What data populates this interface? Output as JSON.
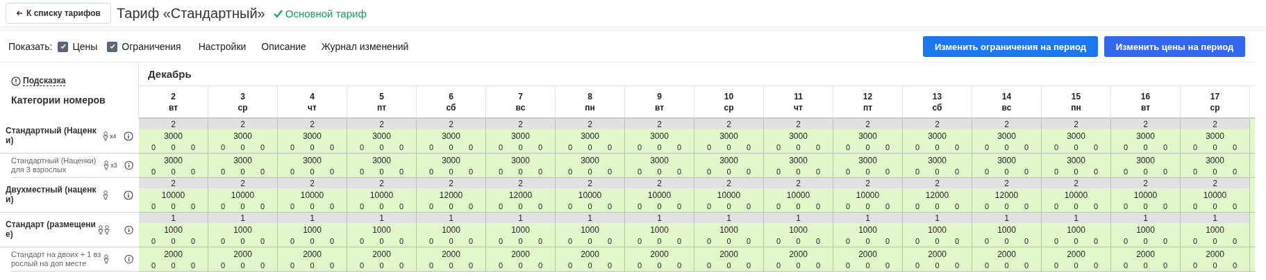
{
  "header": {
    "back_button": "К списку тарифов",
    "title": "Тариф «Стандартный»",
    "status": "Основной тариф"
  },
  "toolbar": {
    "show_label": "Показать:",
    "filters": [
      {
        "label": "Цены",
        "checked": true
      },
      {
        "label": "Ограничения",
        "checked": true
      }
    ],
    "links": [
      "Настройки",
      "Описание",
      "Журнал изменений"
    ],
    "buttons": [
      {
        "label": "Изменить ограничения на период",
        "kind": "restrictions"
      },
      {
        "label": "Изменить цены на период",
        "kind": "prices"
      }
    ]
  },
  "table": {
    "hint": "Подсказка",
    "categories_heading": "Категории номеров",
    "month": "Декабрь",
    "days": [
      {
        "date": "2",
        "weekday": "вт"
      },
      {
        "date": "3",
        "weekday": "ср"
      },
      {
        "date": "4",
        "weekday": "чт"
      },
      {
        "date": "5",
        "weekday": "пт"
      },
      {
        "date": "6",
        "weekday": "сб"
      },
      {
        "date": "7",
        "weekday": "вс"
      },
      {
        "date": "8",
        "weekday": "пн"
      },
      {
        "date": "9",
        "weekday": "вт"
      },
      {
        "date": "10",
        "weekday": "ср"
      },
      {
        "date": "11",
        "weekday": "чт"
      },
      {
        "date": "12",
        "weekday": "пт"
      },
      {
        "date": "13",
        "weekday": "сб"
      },
      {
        "date": "14",
        "weekday": "вс"
      },
      {
        "date": "15",
        "weekday": "пн"
      },
      {
        "date": "16",
        "weekday": "вт"
      },
      {
        "date": "17",
        "weekday": "ср"
      }
    ],
    "rows": [
      {
        "name": "Стандартный (Наценки)",
        "kind": "main",
        "guest_icons": [
          {
            "kind": "adult"
          }
        ],
        "multiplier": "x4",
        "cells": [
          {
            "availability": "2",
            "price": "3000",
            "extras": [
              "0",
              "0",
              "0"
            ]
          },
          {
            "availability": "2",
            "price": "3000",
            "extras": [
              "0",
              "0",
              "0"
            ]
          },
          {
            "availability": "2",
            "price": "3000",
            "extras": [
              "0",
              "0",
              "0"
            ]
          },
          {
            "availability": "2",
            "price": "3000",
            "extras": [
              "0",
              "0",
              "0"
            ]
          },
          {
            "availability": "2",
            "price": "3000",
            "extras": [
              "0",
              "0",
              "0"
            ]
          },
          {
            "availability": "2",
            "price": "3000",
            "extras": [
              "0",
              "0",
              "0"
            ]
          },
          {
            "availability": "2",
            "price": "3000",
            "extras": [
              "0",
              "0",
              "0"
            ]
          },
          {
            "availability": "2",
            "price": "3000",
            "extras": [
              "0",
              "0",
              "0"
            ]
          },
          {
            "availability": "2",
            "price": "3000",
            "extras": [
              "0",
              "0",
              "0"
            ]
          },
          {
            "availability": "2",
            "price": "3000",
            "extras": [
              "0",
              "0",
              "0"
            ]
          },
          {
            "availability": "2",
            "price": "3000",
            "extras": [
              "0",
              "0",
              "0"
            ]
          },
          {
            "availability": "2",
            "price": "3000",
            "extras": [
              "0",
              "0",
              "0"
            ]
          },
          {
            "availability": "2",
            "price": "3000",
            "extras": [
              "0",
              "0",
              "0"
            ]
          },
          {
            "availability": "2",
            "price": "3000",
            "extras": [
              "0",
              "0",
              "0"
            ]
          },
          {
            "availability": "2",
            "price": "3000",
            "extras": [
              "0",
              "0",
              "0"
            ]
          },
          {
            "availability": "2",
            "price": "3000",
            "extras": [
              "0",
              "0",
              "0"
            ]
          }
        ]
      },
      {
        "name": "Стандартный (Наценки) для 3 взрослых",
        "kind": "sub",
        "guest_icons": [
          {
            "kind": "adult"
          }
        ],
        "multiplier": "x3",
        "cells": [
          {
            "price": "3000",
            "extras": [
              "0",
              "0",
              "0"
            ]
          },
          {
            "price": "3000",
            "extras": [
              "0",
              "0",
              "0"
            ]
          },
          {
            "price": "3000",
            "extras": [
              "0",
              "0",
              "0"
            ]
          },
          {
            "price": "3000",
            "extras": [
              "0",
              "0",
              "0"
            ]
          },
          {
            "price": "3000",
            "extras": [
              "0",
              "0",
              "0"
            ]
          },
          {
            "price": "3000",
            "extras": [
              "0",
              "0",
              "0"
            ]
          },
          {
            "price": "3000",
            "extras": [
              "0",
              "0",
              "0"
            ]
          },
          {
            "price": "3000",
            "extras": [
              "0",
              "0",
              "0"
            ]
          },
          {
            "price": "3000",
            "extras": [
              "0",
              "0",
              "0"
            ]
          },
          {
            "price": "3000",
            "extras": [
              "0",
              "0",
              "0"
            ]
          },
          {
            "price": "3000",
            "extras": [
              "0",
              "0",
              "0"
            ]
          },
          {
            "price": "3000",
            "extras": [
              "0",
              "0",
              "0"
            ]
          },
          {
            "price": "3000",
            "extras": [
              "0",
              "0",
              "0"
            ]
          },
          {
            "price": "3000",
            "extras": [
              "0",
              "0",
              "0"
            ]
          },
          {
            "price": "3000",
            "extras": [
              "0",
              "0",
              "0"
            ]
          },
          {
            "price": "3000",
            "extras": [
              "0",
              "0",
              "0"
            ]
          }
        ]
      },
      {
        "name": "Двухместный (наценки)",
        "kind": "main",
        "guest_icons": [
          {
            "kind": "adult"
          }
        ],
        "cells": [
          {
            "availability": "2",
            "price": "10000",
            "extras": [
              "0",
              "0",
              "0"
            ]
          },
          {
            "availability": "2",
            "price": "10000",
            "extras": [
              "0",
              "0",
              "0"
            ]
          },
          {
            "availability": "2",
            "price": "10000",
            "extras": [
              "0",
              "0",
              "0"
            ]
          },
          {
            "availability": "2",
            "price": "10000",
            "extras": [
              "0",
              "0",
              "0"
            ]
          },
          {
            "availability": "2",
            "price": "12000",
            "extras": [
              "0",
              "0",
              "0"
            ]
          },
          {
            "availability": "2",
            "price": "12000",
            "extras": [
              "0",
              "0",
              "0"
            ]
          },
          {
            "availability": "2",
            "price": "10000",
            "extras": [
              "0",
              "0",
              "0"
            ]
          },
          {
            "availability": "2",
            "price": "10000",
            "extras": [
              "0",
              "0",
              "0"
            ]
          },
          {
            "availability": "2",
            "price": "10000",
            "extras": [
              "0",
              "0",
              "0"
            ]
          },
          {
            "availability": "2",
            "price": "10000",
            "extras": [
              "0",
              "0",
              "0"
            ]
          },
          {
            "availability": "2",
            "price": "10000",
            "extras": [
              "0",
              "0",
              "0"
            ]
          },
          {
            "availability": "2",
            "price": "12000",
            "extras": [
              "0",
              "0",
              "0"
            ]
          },
          {
            "availability": "2",
            "price": "12000",
            "extras": [
              "0",
              "0",
              "0"
            ]
          },
          {
            "availability": "2",
            "price": "10000",
            "extras": [
              "0",
              "0",
              "0"
            ]
          },
          {
            "availability": "2",
            "price": "10000",
            "extras": [
              "0",
              "0",
              "0"
            ]
          },
          {
            "availability": "2",
            "price": "10000",
            "extras": [
              "0",
              "0",
              "0"
            ]
          }
        ]
      },
      {
        "name": "Стандарт (размещение)",
        "kind": "main",
        "guest_icons": [
          {
            "kind": "adult"
          },
          {
            "kind": "adult"
          }
        ],
        "cells": [
          {
            "availability": "1",
            "price": "1000",
            "extras": [
              "0",
              "0",
              "0"
            ]
          },
          {
            "availability": "1",
            "price": "1000",
            "extras": [
              "0",
              "0",
              "0"
            ]
          },
          {
            "availability": "1",
            "price": "1000",
            "extras": [
              "0",
              "0",
              "0"
            ]
          },
          {
            "availability": "1",
            "price": "1000",
            "extras": [
              "0",
              "0",
              "0"
            ]
          },
          {
            "availability": "1",
            "price": "1000",
            "extras": [
              "0",
              "0",
              "0"
            ]
          },
          {
            "availability": "1",
            "price": "1000",
            "extras": [
              "0",
              "0",
              "0"
            ]
          },
          {
            "availability": "1",
            "price": "1000",
            "extras": [
              "0",
              "0",
              "0"
            ]
          },
          {
            "availability": "1",
            "price": "1000",
            "extras": [
              "0",
              "0",
              "0"
            ]
          },
          {
            "availability": "1",
            "price": "1000",
            "extras": [
              "0",
              "0",
              "0"
            ]
          },
          {
            "availability": "1",
            "price": "1000",
            "extras": [
              "0",
              "0",
              "0"
            ]
          },
          {
            "availability": "1",
            "price": "1000",
            "extras": [
              "0",
              "0",
              "0"
            ]
          },
          {
            "availability": "1",
            "price": "1000",
            "extras": [
              "0",
              "0",
              "0"
            ]
          },
          {
            "availability": "1",
            "price": "1000",
            "extras": [
              "0",
              "0",
              "0"
            ]
          },
          {
            "availability": "1",
            "price": "1000",
            "extras": [
              "0",
              "0",
              "0"
            ]
          },
          {
            "availability": "1",
            "price": "1000",
            "extras": [
              "0",
              "0",
              "0"
            ]
          },
          {
            "availability": "1",
            "price": "1000",
            "extras": [
              "0",
              "0",
              "0"
            ]
          }
        ]
      },
      {
        "name": "Стандарт на двоих + 1 взрослый на доп месте",
        "kind": "sub",
        "guest_icons": [
          {
            "kind": "adult"
          }
        ],
        "cells": [
          {
            "price": "2000",
            "extras": [
              "0",
              "0",
              "0"
            ]
          },
          {
            "price": "2000",
            "extras": [
              "0",
              "0",
              "0"
            ]
          },
          {
            "price": "2000",
            "extras": [
              "0",
              "0",
              "0"
            ]
          },
          {
            "price": "2000",
            "extras": [
              "0",
              "0",
              "0"
            ]
          },
          {
            "price": "2000",
            "extras": [
              "0",
              "0",
              "0"
            ]
          },
          {
            "price": "2000",
            "extras": [
              "0",
              "0",
              "0"
            ]
          },
          {
            "price": "2000",
            "extras": [
              "0",
              "0",
              "0"
            ]
          },
          {
            "price": "2000",
            "extras": [
              "0",
              "0",
              "0"
            ]
          },
          {
            "price": "2000",
            "extras": [
              "0",
              "0",
              "0"
            ]
          },
          {
            "price": "2000",
            "extras": [
              "0",
              "0",
              "0"
            ]
          },
          {
            "price": "2000",
            "extras": [
              "0",
              "0",
              "0"
            ]
          },
          {
            "price": "2000",
            "extras": [
              "0",
              "0",
              "0"
            ]
          },
          {
            "price": "2000",
            "extras": [
              "0",
              "0",
              "0"
            ]
          },
          {
            "price": "2000",
            "extras": [
              "0",
              "0",
              "0"
            ]
          },
          {
            "price": "2000",
            "extras": [
              "0",
              "0",
              "0"
            ]
          },
          {
            "price": "2000",
            "extras": [
              "0",
              "0",
              "0"
            ]
          }
        ]
      }
    ]
  }
}
